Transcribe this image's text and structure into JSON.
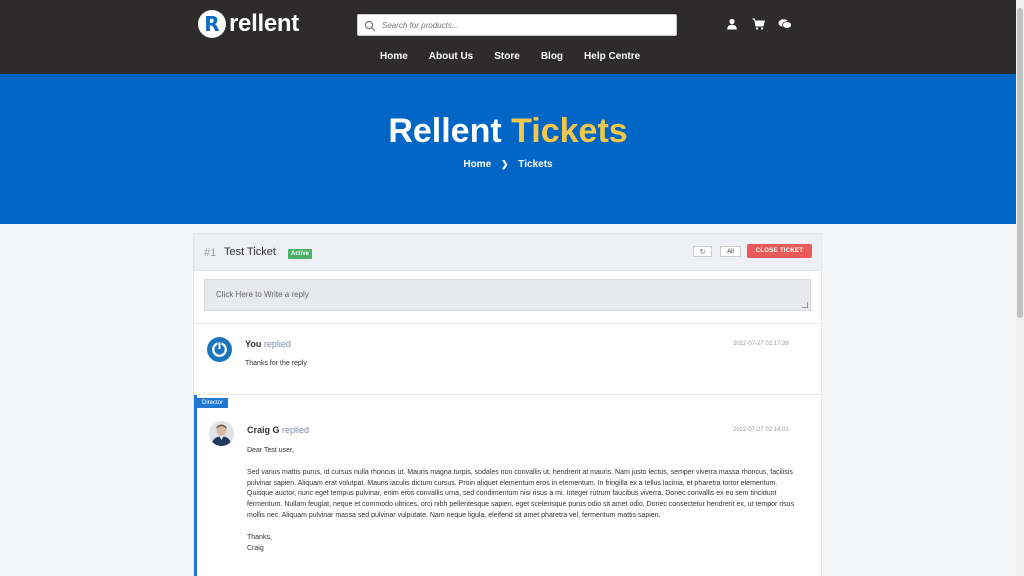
{
  "header": {
    "logo_letter": "R",
    "logo_text": "rellent",
    "search_placeholder": "Search for products...",
    "icons": [
      "user-icon",
      "cart-icon",
      "chat-icon"
    ],
    "nav": [
      "Home",
      "About Us",
      "Store",
      "Blog",
      "Help Centre"
    ]
  },
  "hero": {
    "title_main": "Rellent",
    "title_accent": "Tickets",
    "breadcrumb": [
      "Home",
      "Tickets"
    ],
    "bg_color": "#0066c6",
    "accent_color": "#f3c84a"
  },
  "ticket": {
    "number": "#1",
    "name": "Test Ticket",
    "status": "Active",
    "filter_label": "All",
    "close_label": "CLOSE TICKET",
    "reply_prompt": "Click Here to Write a reply"
  },
  "replies": [
    {
      "author": "You",
      "action": "replied",
      "date": "2022-07-27 02:17:39",
      "text": "Thanks for the reply"
    },
    {
      "role": "Director",
      "author": "Craig G",
      "action": "replied",
      "date": "2022-07-27 02:14:01",
      "greeting": "Dear Test user,",
      "body": "Sed varius mattis purus, id cursus nulla rhoncus ut. Mauris magna turpis, sodales non convallis ut, hendrerit at mauris. Nam justo lectus, semper viverra massa rhoncus, facilisis pulvinar sapien. Aliquam erat volutpat. Mauris iaculis dictum cursus. Proin aliquet elementum eros in elementum. In fringilla ex a tellus lacinia, et pharetra tortor elementum. Quisque auctor, nunc eget tempus pulvinar, enim eros convallis urna, sed condimentum nisi risus a mi. Integer rutrum faucibus viverra. Donec convallis ex eu sem tincidunt fermentum. Nullam feugiat, neque et commodo ultrices, orci nibh pellentesque sapien, eget scelerisque purus odio sit amet odio. Donec consectetur hendrerit ex, ut tempor risus mollis nec. Aliquam pulvinar massa sed pulvinar vulputate. Nam neque ligula, eleifend sit amet pharetra vel, fermentum mattis sapien.",
      "signoff": "Thanks,",
      "signature": "Craig"
    }
  ]
}
